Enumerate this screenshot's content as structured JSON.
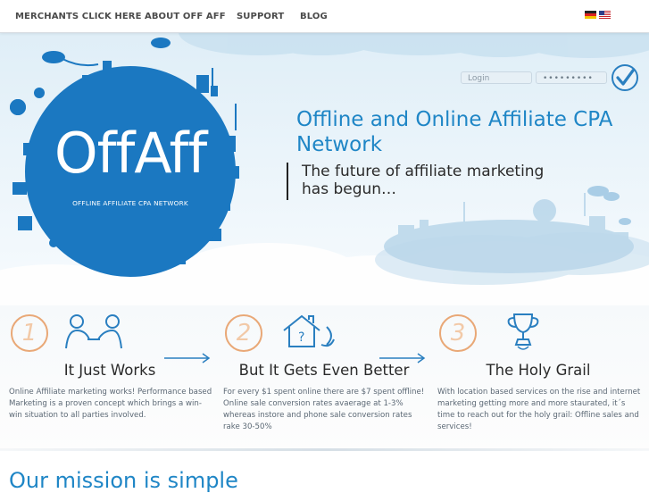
{
  "nav": {
    "items": [
      {
        "label": "MERCHANTS CLICK HERE"
      },
      {
        "label": "ABOUT OFF AFF"
      },
      {
        "label": "SUPPORT"
      },
      {
        "label": "BLOG"
      }
    ],
    "flags": [
      "de-flag-icon",
      "us-flag-icon"
    ]
  },
  "hero": {
    "logo_text": "OffAff",
    "logo_tagline": "OFFLINE AFFILIATE CPA NETWORK",
    "login_placeholder": "Login",
    "password_mask": "•••••••••",
    "headline": "Offline and Online Affiliate CPA Network",
    "subheadline": "The future of affiliate marketing has begun…",
    "colors": {
      "brand_blue": "#1f86c6",
      "logo_disc": "#1b78c1",
      "accent_orange": "#e9a877"
    }
  },
  "features": [
    {
      "number": "1",
      "icon": "handshake-icon",
      "title": "It Just Works",
      "body": "Online Affiliate marketing works! Performance based Marketing is a proven concept which brings a win-win situation to all parties involved."
    },
    {
      "number": "2",
      "icon": "house-phone-icon",
      "title": "But It Gets Even Better",
      "body": "For every $1 spent online there are $7 spent offline! Online sale conversion rates avaerage at 1-3% whereas instore and phone sale conversion rates rake 30-50%"
    },
    {
      "number": "3",
      "icon": "trophy-icon",
      "title": "The Holy Grail",
      "body": "With location based services on the rise and internet marketing getting more and more staurated, it´s time to reach out for the holy grail: Offline sales and services!"
    }
  ],
  "mission": {
    "heading": "Our mission is simple"
  }
}
